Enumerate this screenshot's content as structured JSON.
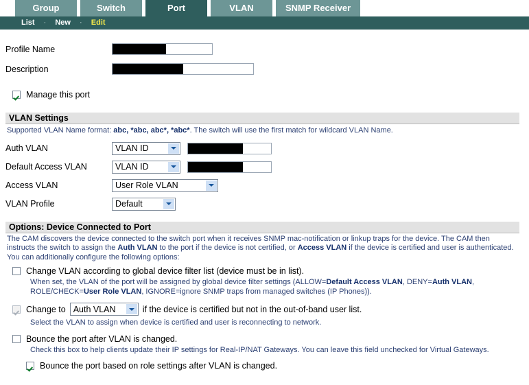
{
  "tabs": [
    {
      "label": "Group",
      "active": false
    },
    {
      "label": "Switch",
      "active": false
    },
    {
      "label": "Port",
      "active": true
    },
    {
      "label": "VLAN",
      "active": false
    },
    {
      "label": "SNMP Receiver",
      "active": false
    }
  ],
  "subnav": {
    "items": [
      "List",
      "New",
      "Edit"
    ],
    "current": "Edit",
    "separator": "·"
  },
  "form": {
    "profile_name_label": "Profile Name",
    "profile_name_value": "",
    "description_label": "Description",
    "description_value": "",
    "manage_port_label": "Manage this port",
    "manage_port_checked": true
  },
  "vlan_settings": {
    "heading": "VLAN Settings",
    "hint_prefix": "Supported VLAN Name format: ",
    "hint_formats": "abc, *abc, abc*, *abc*",
    "hint_suffix": ". The switch will use the first match for wildcard VLAN Name.",
    "rows": [
      {
        "label": "Auth VLAN",
        "select_value": "VLAN ID",
        "has_textbox": true
      },
      {
        "label": "Default Access VLAN",
        "select_value": "VLAN ID",
        "has_textbox": true
      },
      {
        "label": "Access VLAN",
        "select_value": "User Role VLAN",
        "has_textbox": false
      },
      {
        "label": "VLAN Profile",
        "select_value": "Default",
        "has_textbox": false
      }
    ]
  },
  "options": {
    "heading": "Options: Device Connected to Port",
    "intro_1": "The CAM discovers the device connected to the switch port when it receives SNMP mac-notification or linkup traps for the device. The CAM then instructs the switch to assign the ",
    "intro_bold_1": "Auth VLAN",
    "intro_2": " to the port if the device is not certified, or ",
    "intro_bold_2": "Access VLAN",
    "intro_3": " if the device is certified and user is authenticated.",
    "intro_4": "You can additionally configure the following options:",
    "opt1_label": "Change VLAN according to global device filter list (device must be in list).",
    "opt1_checked": false,
    "opt1_note_1": "When set, the VLAN of the port will be assigned by global device filter settings (ALLOW=",
    "opt1_note_b1": "Default Access VLAN",
    "opt1_note_2": ", DENY=",
    "opt1_note_b2": "Auth VLAN",
    "opt1_note_3": ", ROLE/CHECK=",
    "opt1_note_b3": "User Role VLAN",
    "opt1_note_4": ", IGNORE=ignore SNMP traps from managed switches (IP Phones)).",
    "opt2_prefix": "Change to",
    "opt2_select_value": "Auth VLAN",
    "opt2_suffix": "if the device is certified but not in the out-of-band user list.",
    "opt2_checked": true,
    "opt2_disabled": true,
    "opt2_note": "Select the VLAN to assign when device is certified and user is reconnecting to network.",
    "opt3_label": "Bounce the port after VLAN is changed.",
    "opt3_checked": false,
    "opt3_note": "Check this box to help clients update their IP settings for Real-IP/NAT Gateways. You can leave this field unchecked for Virtual Gateways.",
    "opt4_label": "Bounce the port based on role settings after VLAN is changed.",
    "opt4_checked": true
  },
  "colors": {
    "tab_active": "#2f5e5d",
    "tab_inactive": "#6d9696",
    "subnav_current": "#f2e84b",
    "section_header_bg": "#e2e2e2",
    "hint_text": "#2b3f72",
    "check_green": "#0a7b28"
  }
}
